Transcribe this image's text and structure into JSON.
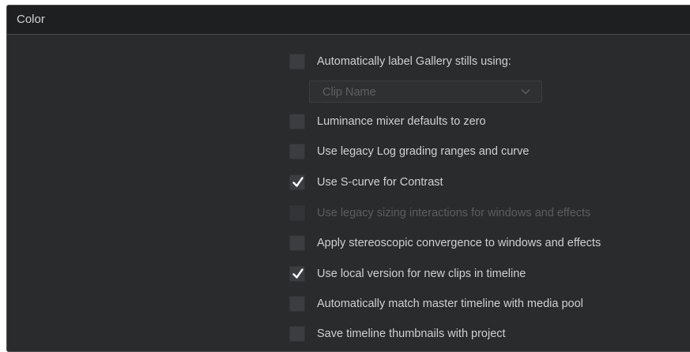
{
  "panel": {
    "title": "Color"
  },
  "gallery_label_source": {
    "selected": "Clip Name",
    "icon": "chevron-down-icon"
  },
  "options": [
    {
      "label": "Automatically label Gallery stills using:",
      "checked": false,
      "enabled": true
    },
    {
      "label": "Luminance mixer defaults to zero",
      "checked": false,
      "enabled": true
    },
    {
      "label": "Use legacy Log grading ranges and curve",
      "checked": false,
      "enabled": true
    },
    {
      "label": "Use S-curve for Contrast",
      "checked": true,
      "enabled": true
    },
    {
      "label": "Use legacy sizing interactions for windows and effects",
      "checked": false,
      "enabled": false
    },
    {
      "label": "Apply stereoscopic convergence to windows and effects",
      "checked": false,
      "enabled": true
    },
    {
      "label": "Use local version for new clips in timeline",
      "checked": true,
      "enabled": true
    },
    {
      "label": "Automatically match master timeline with media pool",
      "checked": false,
      "enabled": true
    },
    {
      "label": "Save timeline thumbnails with project",
      "checked": false,
      "enabled": true
    }
  ],
  "colors": {
    "panel_bg": "#2a2b2d",
    "header_bg": "#1e1f21",
    "text": "#d0d0d0",
    "disabled_text": "#5c5d60",
    "checkmark": "#ffffff"
  }
}
